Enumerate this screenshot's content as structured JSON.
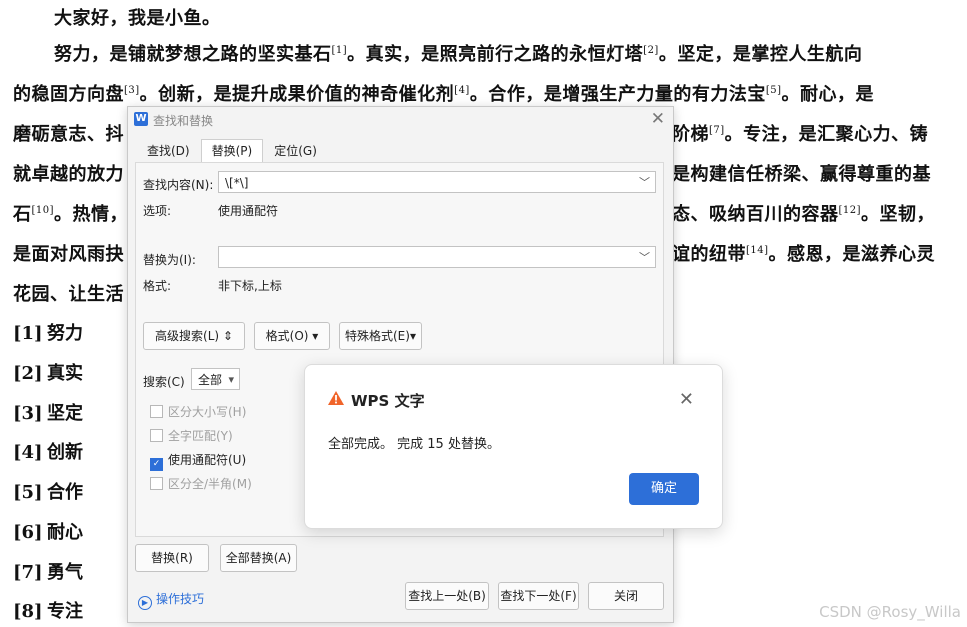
{
  "document": {
    "greeting": "大家好，我是小鱼。",
    "lines": [
      {
        "text": "努力，是铺就梦想之路的坚实基石",
        "sup": "[1]",
        "tail": "。真实，是照亮前行之路的永恒灯塔",
        "sup2": "[2]",
        "tail2": "。坚定，是掌控人生航向"
      },
      {
        "text": "的稳固方向盘",
        "sup": "[3]",
        "tail": "。创新，是提升成果价值的神奇催化剂",
        "sup2": "[4]",
        "tail2": "。合作，是增强生产力量的有力法宝",
        "sup3": "[5]",
        "tail3": "。耐心，是"
      },
      {
        "left": "磨砺意志、抖",
        "right": "阶梯",
        "rsup": "[7]",
        "rtail": "。专注，是汇聚心力、铸"
      },
      {
        "left": "就卓越的放力",
        "right": "是构建信任桥梁、赢得尊重的基"
      },
      {
        "left": "石",
        "lsup": "[10]",
        "ltail": "。热情，",
        "right": "态、吸纳百川的容器",
        "rsup": "[12]",
        "rtail": "。坚韧，"
      },
      {
        "left": "是面对风雨抉",
        "right": "谊的纽带",
        "rsup": "[14]",
        "rtail": "。感恩，是滋养心灵"
      },
      {
        "left": "花园、让生活"
      }
    ],
    "references": [
      {
        "num": "[1]",
        "word": "努力"
      },
      {
        "num": "[2]",
        "word": "真实"
      },
      {
        "num": "[3]",
        "word": "坚定"
      },
      {
        "num": "[4]",
        "word": "创新"
      },
      {
        "num": "[5]",
        "word": "合作"
      },
      {
        "num": "[6]",
        "word": "耐心"
      },
      {
        "num": "[7]",
        "word": "勇气"
      },
      {
        "num": "[8]",
        "word": "专注"
      }
    ],
    "watermark": "CSDN @Rosy_Willa"
  },
  "find_replace": {
    "title": "查找和替换",
    "logo": "W",
    "tabs": [
      "查找(D)",
      "替换(P)",
      "定位(G)"
    ],
    "active_tab": 1,
    "find_label": "查找内容(N):",
    "find_value": "\\[*\\]",
    "options_label": "选项:",
    "options_value": "使用通配符",
    "replace_label": "替换为(I):",
    "replace_value": "",
    "format_label": "格式:",
    "format_value": "非下标,上标",
    "advanced_button": "高级搜索(L)",
    "format_button": "格式(O)",
    "special_button": "特殊格式(E)",
    "search_label": "搜索(C)",
    "search_value": "全部",
    "checkboxes": [
      {
        "label": "区分大小写(H)",
        "checked": false
      },
      {
        "label": "全字匹配(Y)",
        "checked": false
      },
      {
        "label": "使用通配符(U)",
        "checked": true
      },
      {
        "label": "区分全/半角(M)",
        "checked": false
      }
    ],
    "replace_button": "替换(R)",
    "replace_all_button": "全部替换(A)",
    "tips_link": "操作技巧",
    "find_prev_button": "查找上一处(B)",
    "find_next_button": "查找下一处(F)",
    "close_button": "关闭"
  },
  "message_box": {
    "title": "WPS 文字",
    "message": "全部完成。 完成 15 处替换。",
    "ok_button": "确定",
    "warn_color": "#f0642a"
  }
}
